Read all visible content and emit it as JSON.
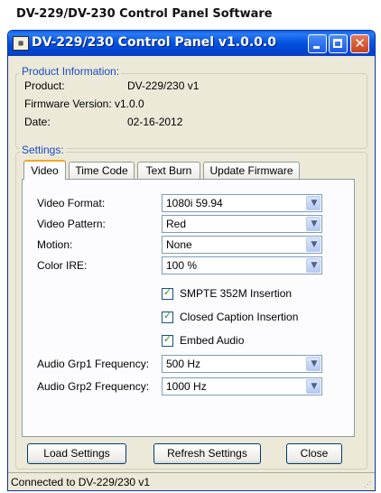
{
  "page_caption": "DV-229/DV-230 Control Panel Software",
  "window": {
    "title": "DV-229/230 Control Panel v1.0.0.0",
    "icon": "app-icon",
    "controls": {
      "minimize": "minimize-icon",
      "maximize": "maximize-icon",
      "close": "✕"
    }
  },
  "product_info": {
    "legend": "Product Information:",
    "rows": [
      {
        "label": "Product:",
        "value": "DV-229/230 v1"
      },
      {
        "label": "Firmware Version:",
        "value": "v1.0.0"
      },
      {
        "label": "Date:",
        "value": "02-16-2012"
      }
    ]
  },
  "settings": {
    "legend": "Settings:",
    "tabs": [
      "Video",
      "Time Code",
      "Text Burn",
      "Update Firmware"
    ],
    "active_tab": "Video",
    "fields": [
      {
        "label": "Video Format:",
        "value": "1080i 59.94"
      },
      {
        "label": "Video Pattern:",
        "value": "Red"
      },
      {
        "label": "Motion:",
        "value": "None"
      },
      {
        "label": "Color IRE:",
        "value": "100 %"
      }
    ],
    "checkboxes": [
      {
        "label": "SMPTE 352M Insertion",
        "checked": true
      },
      {
        "label": "Closed Caption Insertion",
        "checked": true
      },
      {
        "label": "Embed Audio",
        "checked": true
      }
    ],
    "audio_fields": [
      {
        "label": "Audio Grp1 Frequency:",
        "value": "500 Hz"
      },
      {
        "label": "Audio Grp2 Frequency:",
        "value": "1000 Hz"
      }
    ]
  },
  "buttons": {
    "load": "Load Settings",
    "refresh": "Refresh Settings",
    "close": "Close"
  },
  "status": "Connected to DV-229/230 v1",
  "colors": {
    "titlebar": "#0a5fe4",
    "window_bg": "#ece9d8",
    "legend_text": "#1c4bc4",
    "active_tab_highlight": "#f5a623",
    "checkmark": "#21a121"
  },
  "tick_glyph": "✓",
  "dropdown_glyph": "▼"
}
